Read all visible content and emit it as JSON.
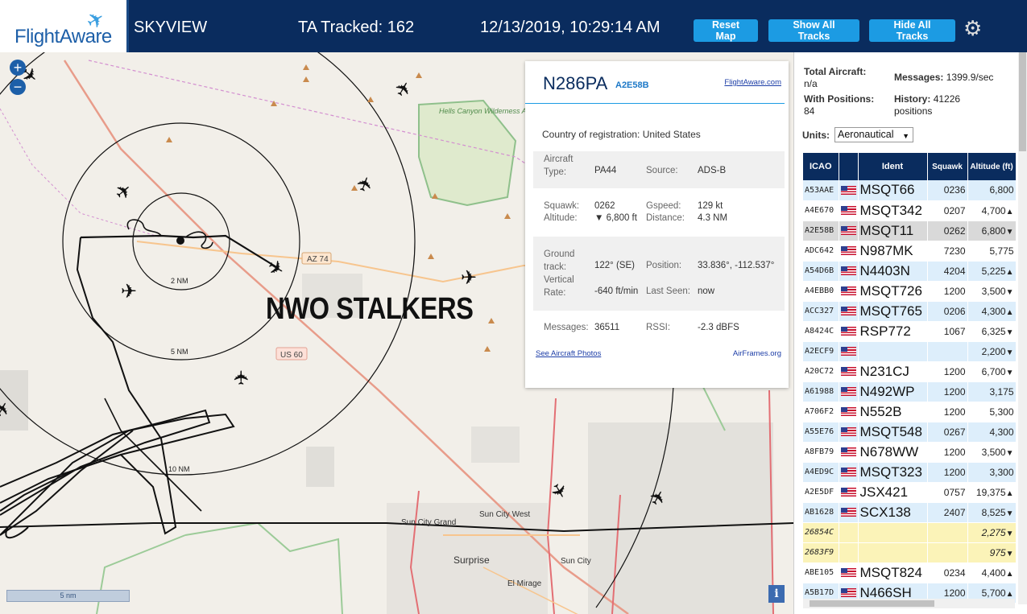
{
  "header": {
    "logo": "FlightAware",
    "app_title": "SKYVIEW",
    "ta_tracked": "TA Tracked: 162",
    "clock": "12/13/2019, 10:29:14 AM",
    "buttons": {
      "reset": "Reset Map",
      "show_all": "Show All Tracks",
      "hide_all": "Hide All Tracks"
    },
    "settings_icon": "gear-icon"
  },
  "map": {
    "zoom_in": "+",
    "zoom_out": "−",
    "overlay_text": "NWO STALKERS",
    "scale_label": "5 nm",
    "info_icon": "i",
    "labels": {
      "wilderness": "Hells Canyon Wilderness Area",
      "az74": "AZ 74",
      "us60": "US 60",
      "ring_2": "2 NM",
      "ring_5": "5 NM",
      "ring_10": "10 NM",
      "sun_city_grand": "Sun City Grand",
      "sun_city_west": "Sun City West",
      "surprise": "Surprise",
      "sun_city": "Sun City",
      "el_mirage": "El Mirage"
    }
  },
  "popup": {
    "callsign": "N286PA",
    "hex": "A2E58B",
    "fa_link": "FlightAware.com",
    "country_label": "Country of registration:",
    "country": "United States",
    "aircraft_type_label": "Aircraft Type:",
    "aircraft_type": "PA44",
    "source_label": "Source:",
    "source": "ADS-B",
    "squawk_label": "Squawk:",
    "squawk": "0262",
    "gspeed_label": "Gspeed:",
    "gspeed": "129 kt",
    "altitude_label": "Altitude:",
    "altitude": "▼ 6,800 ft",
    "distance_label": "Distance:",
    "distance": "4.3 NM",
    "track_label": "Ground track:",
    "track": "122° (SE)",
    "position_label": "Position:",
    "position": "33.836°, -112.537°",
    "vrate_label": "Vertical Rate:",
    "vrate": "-640 ft/min",
    "last_seen_label": "Last Seen:",
    "last_seen": "now",
    "messages_label": "Messages:",
    "messages": "36511",
    "rssi_label": "RSSI:",
    "rssi": "-2.3 dBFS",
    "photos_link": "See Aircraft Photos",
    "airframes_link": "AirFrames.org"
  },
  "sidebar": {
    "total_aircraft_label": "Total Aircraft:",
    "total_aircraft": "n/a",
    "messages_label": "Messages:",
    "messages": "1399.9/sec",
    "with_positions_label": "With Positions:",
    "with_positions": "84",
    "history_label": "History:",
    "history": "41226",
    "history_unit": "positions",
    "units_label": "Units:",
    "units_value": "Aeronautical",
    "columns": [
      "ICAO",
      "",
      "Ident",
      "Squawk",
      "Altitude (ft)"
    ],
    "rows": [
      {
        "icao": "A53AAE",
        "ident": "MSQT66",
        "squawk": "0236",
        "alt": "6,800",
        "trend": "",
        "kind": "odd"
      },
      {
        "icao": "A4E670",
        "ident": "MSQT342",
        "squawk": "0207",
        "alt": "4,700",
        "trend": "▲",
        "kind": "even"
      },
      {
        "icao": "A2E58B",
        "ident": "MSQT11",
        "squawk": "0262",
        "alt": "6,800",
        "trend": "▼",
        "kind": "sel"
      },
      {
        "icao": "ADC642",
        "ident": "N987MK",
        "squawk": "7230",
        "alt": "5,775",
        "trend": "",
        "kind": "even"
      },
      {
        "icao": "A54D6B",
        "ident": "N4403N",
        "squawk": "4204",
        "alt": "5,225",
        "trend": "▲",
        "kind": "odd"
      },
      {
        "icao": "A4EBB0",
        "ident": "MSQT726",
        "squawk": "1200",
        "alt": "3,500",
        "trend": "▼",
        "kind": "even"
      },
      {
        "icao": "ACC327",
        "ident": "MSQT765",
        "squawk": "0206",
        "alt": "4,300",
        "trend": "▲",
        "kind": "odd"
      },
      {
        "icao": "A8424C",
        "ident": "RSP772",
        "squawk": "1067",
        "alt": "6,325",
        "trend": "▼",
        "kind": "even"
      },
      {
        "icao": "A2ECF9",
        "ident": "",
        "squawk": "",
        "alt": "2,200",
        "trend": "▼",
        "kind": "odd"
      },
      {
        "icao": "A20C72",
        "ident": "N231CJ",
        "squawk": "1200",
        "alt": "6,700",
        "trend": "▼",
        "kind": "even"
      },
      {
        "icao": "A61988",
        "ident": "N492WP",
        "squawk": "1200",
        "alt": "3,175",
        "trend": "",
        "kind": "odd"
      },
      {
        "icao": "A706F2",
        "ident": "N552B",
        "squawk": "1200",
        "alt": "5,300",
        "trend": "",
        "kind": "even"
      },
      {
        "icao": "A55E76",
        "ident": "MSQT548",
        "squawk": "0267",
        "alt": "4,300",
        "trend": "",
        "kind": "odd"
      },
      {
        "icao": "A8FB79",
        "ident": "N678WW",
        "squawk": "1200",
        "alt": "3,500",
        "trend": "▼",
        "kind": "even"
      },
      {
        "icao": "A4ED9C",
        "ident": "MSQT323",
        "squawk": "1200",
        "alt": "3,300",
        "trend": "",
        "kind": "odd"
      },
      {
        "icao": "A2E5DF",
        "ident": "JSX421",
        "squawk": "0757",
        "alt": "19,375",
        "trend": "▲",
        "kind": "even"
      },
      {
        "icao": "AB1628",
        "ident": "SCX138",
        "squawk": "2407",
        "alt": "8,525",
        "trend": "▼",
        "kind": "odd"
      },
      {
        "icao": "26854C",
        "ident": "",
        "squawk": "",
        "alt": "2,275",
        "trend": "▼",
        "kind": "mlat"
      },
      {
        "icao": "2683F9",
        "ident": "",
        "squawk": "",
        "alt": "975",
        "trend": "▼",
        "kind": "mlat"
      },
      {
        "icao": "ABE105",
        "ident": "MSQT824",
        "squawk": "0234",
        "alt": "4,400",
        "trend": "▲",
        "kind": "even"
      },
      {
        "icao": "A5B17D",
        "ident": "N466SH",
        "squawk": "1200",
        "alt": "5,700",
        "trend": "▲",
        "kind": "odd"
      }
    ]
  }
}
